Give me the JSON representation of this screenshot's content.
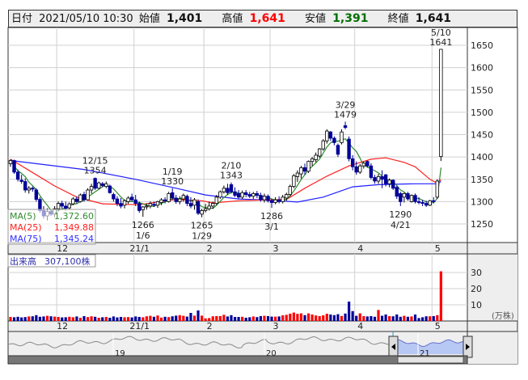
{
  "header": {
    "date_label": "日付",
    "datetime": "2021/05/10 10:30",
    "open_label": "始値",
    "open": "1,401",
    "high_label": "高値",
    "high": "1,641",
    "low_label": "安値",
    "low": "1,391",
    "close_label": "終値",
    "close": "1,641"
  },
  "legend": {
    "ma5_label": "MA(5)",
    "ma5_value": "1,372.60",
    "ma25_label": "MA(25)",
    "ma25_value": "1,349.88",
    "ma75_label": "MA(75)",
    "ma75_value": "1,345.24"
  },
  "volume_label": {
    "label": "出来高",
    "value": "307,100株"
  },
  "colors": {
    "up_candle": "#ffffff",
    "down_candle": "#000099",
    "ma5": "#2e8b2e",
    "ma25": "#ff2020",
    "ma75": "#2020ff",
    "vol_up": "#ff0000",
    "vol_down": "#000099",
    "vol_flat": "#999999",
    "high_text": "#ff0000",
    "low_text": "#007000"
  },
  "chart_data": {
    "type": "candlestick",
    "price_axis": {
      "ticks": [
        1650,
        1600,
        1550,
        1500,
        1450,
        1400,
        1350,
        1300,
        1250
      ],
      "ylim": [
        1212,
        1688
      ]
    },
    "month_ticks": [
      {
        "label": "12",
        "index": 13
      },
      {
        "label": "21/1",
        "index": 34
      },
      {
        "label": "2",
        "index": 53
      },
      {
        "label": "3",
        "index": 71
      },
      {
        "label": "4",
        "index": 94
      },
      {
        "label": "5",
        "index": 115
      }
    ],
    "ohlc": [
      [
        1385,
        1395,
        1378,
        1392
      ],
      [
        1392,
        1394,
        1362,
        1366
      ],
      [
        1366,
        1372,
        1345,
        1350
      ],
      [
        1348,
        1360,
        1340,
        1345
      ],
      [
        1345,
        1352,
        1320,
        1326
      ],
      [
        1326,
        1335,
        1318,
        1330
      ],
      [
        1330,
        1334,
        1322,
        1328
      ],
      [
        1326,
        1330,
        1300,
        1305
      ],
      [
        1305,
        1310,
        1275,
        1280
      ],
      [
        1280,
        1290,
        1262,
        1268
      ],
      [
        1268,
        1285,
        1258,
        1278
      ],
      [
        1278,
        1282,
        1268,
        1272
      ],
      [
        1272,
        1290,
        1265,
        1284
      ],
      [
        1284,
        1300,
        1278,
        1296
      ],
      [
        1296,
        1302,
        1285,
        1290
      ],
      [
        1290,
        1300,
        1280,
        1285
      ],
      [
        1286,
        1298,
        1282,
        1295
      ],
      [
        1295,
        1310,
        1292,
        1306
      ],
      [
        1306,
        1312,
        1296,
        1300
      ],
      [
        1300,
        1318,
        1298,
        1315
      ],
      [
        1316,
        1322,
        1300,
        1304
      ],
      [
        1304,
        1330,
        1302,
        1326
      ],
      [
        1326,
        1340,
        1318,
        1334
      ],
      [
        1352,
        1354,
        1326,
        1330
      ],
      [
        1330,
        1345,
        1328,
        1342
      ],
      [
        1340,
        1344,
        1332,
        1336
      ],
      [
        1334,
        1345,
        1330,
        1340
      ],
      [
        1335,
        1338,
        1318,
        1320
      ],
      [
        1316,
        1320,
        1300,
        1306
      ],
      [
        1306,
        1312,
        1290,
        1296
      ],
      [
        1296,
        1308,
        1285,
        1290
      ],
      [
        1292,
        1305,
        1285,
        1302
      ],
      [
        1300,
        1312,
        1295,
        1308
      ],
      [
        1310,
        1318,
        1300,
        1304
      ],
      [
        1304,
        1315,
        1290,
        1296
      ],
      [
        1296,
        1300,
        1275,
        1280
      ],
      [
        1282,
        1290,
        1266,
        1288
      ],
      [
        1288,
        1296,
        1282,
        1290
      ],
      [
        1290,
        1300,
        1285,
        1296
      ],
      [
        1294,
        1300,
        1288,
        1292
      ],
      [
        1292,
        1302,
        1286,
        1300
      ],
      [
        1298,
        1308,
        1292,
        1304
      ],
      [
        1304,
        1310,
        1296,
        1302
      ],
      [
        1300,
        1322,
        1298,
        1318
      ],
      [
        1320,
        1330,
        1305,
        1308
      ],
      [
        1308,
        1315,
        1295,
        1300
      ],
      [
        1300,
        1312,
        1294,
        1306
      ],
      [
        1306,
        1318,
        1300,
        1314
      ],
      [
        1312,
        1316,
        1290,
        1296
      ],
      [
        1296,
        1310,
        1285,
        1290
      ],
      [
        1292,
        1308,
        1282,
        1304
      ],
      [
        1300,
        1305,
        1270,
        1274
      ],
      [
        1272,
        1284,
        1265,
        1280
      ],
      [
        1280,
        1295,
        1276,
        1284
      ],
      [
        1284,
        1300,
        1280,
        1290
      ],
      [
        1290,
        1300,
        1284,
        1296
      ],
      [
        1296,
        1315,
        1292,
        1310
      ],
      [
        1310,
        1325,
        1306,
        1322
      ],
      [
        1322,
        1336,
        1318,
        1330
      ],
      [
        1330,
        1340,
        1315,
        1320
      ],
      [
        1338,
        1343,
        1318,
        1322
      ],
      [
        1322,
        1332,
        1310,
        1314
      ],
      [
        1318,
        1326,
        1306,
        1310
      ],
      [
        1310,
        1325,
        1306,
        1320
      ],
      [
        1320,
        1326,
        1310,
        1316
      ],
      [
        1316,
        1322,
        1308,
        1312
      ],
      [
        1312,
        1322,
        1306,
        1318
      ],
      [
        1318,
        1324,
        1308,
        1314
      ],
      [
        1314,
        1320,
        1300,
        1304
      ],
      [
        1304,
        1318,
        1298,
        1312
      ],
      [
        1312,
        1316,
        1298,
        1302
      ],
      [
        1302,
        1306,
        1286,
        1298
      ],
      [
        1298,
        1310,
        1294,
        1304
      ],
      [
        1304,
        1312,
        1296,
        1300
      ],
      [
        1300,
        1315,
        1296,
        1310
      ],
      [
        1308,
        1320,
        1302,
        1316
      ],
      [
        1316,
        1338,
        1312,
        1334
      ],
      [
        1334,
        1362,
        1330,
        1358
      ],
      [
        1356,
        1370,
        1344,
        1364
      ],
      [
        1362,
        1380,
        1352,
        1376
      ],
      [
        1376,
        1385,
        1360,
        1368
      ],
      [
        1368,
        1392,
        1364,
        1390
      ],
      [
        1390,
        1400,
        1380,
        1396
      ],
      [
        1394,
        1410,
        1388,
        1404
      ],
      [
        1402,
        1420,
        1398,
        1418
      ],
      [
        1418,
        1440,
        1414,
        1436
      ],
      [
        1436,
        1462,
        1430,
        1458
      ],
      [
        1456,
        1458,
        1436,
        1442
      ],
      [
        1442,
        1446,
        1426,
        1432
      ],
      [
        1426,
        1430,
        1400,
        1406
      ],
      [
        1432,
        1462,
        1428,
        1456
      ],
      [
        1470,
        1479,
        1462,
        1466
      ],
      [
        1440,
        1446,
        1390,
        1396
      ],
      [
        1396,
        1404,
        1370,
        1378
      ],
      [
        1378,
        1390,
        1360,
        1366
      ],
      [
        1366,
        1384,
        1362,
        1380
      ],
      [
        1380,
        1390,
        1374,
        1386
      ],
      [
        1390,
        1392,
        1376,
        1380
      ],
      [
        1380,
        1386,
        1350,
        1354
      ],
      [
        1354,
        1360,
        1340,
        1346
      ],
      [
        1346,
        1362,
        1340,
        1356
      ],
      [
        1356,
        1370,
        1330,
        1350
      ],
      [
        1360,
        1362,
        1334,
        1340
      ],
      [
        1340,
        1352,
        1332,
        1348
      ],
      [
        1348,
        1350,
        1326,
        1330
      ],
      [
        1332,
        1336,
        1306,
        1312
      ],
      [
        1318,
        1322,
        1290,
        1300
      ],
      [
        1310,
        1320,
        1298,
        1318
      ],
      [
        1318,
        1322,
        1302,
        1306
      ],
      [
        1300,
        1316,
        1298,
        1314
      ],
      [
        1314,
        1318,
        1296,
        1300
      ],
      [
        1300,
        1310,
        1294,
        1298
      ],
      [
        1298,
        1304,
        1290,
        1296
      ],
      [
        1296,
        1302,
        1288,
        1292
      ],
      [
        1292,
        1304,
        1290,
        1302
      ],
      [
        1302,
        1310,
        1296,
        1300
      ],
      [
        1310,
        1350,
        1306,
        1346
      ],
      [
        1401,
        1641,
        1391,
        1641
      ]
    ],
    "ma25": [
      [
        0,
        1395
      ],
      [
        5,
        1370
      ],
      [
        12,
        1335
      ],
      [
        18,
        1310
      ],
      [
        25,
        1295
      ],
      [
        35,
        1293
      ],
      [
        45,
        1305
      ],
      [
        52,
        1302
      ],
      [
        55,
        1297
      ],
      [
        62,
        1302
      ],
      [
        70,
        1304
      ],
      [
        75,
        1305
      ],
      [
        80,
        1330
      ],
      [
        86,
        1357
      ],
      [
        92,
        1380
      ],
      [
        98,
        1395
      ],
      [
        102,
        1398
      ],
      [
        107,
        1388
      ],
      [
        110,
        1378
      ],
      [
        114,
        1350
      ],
      [
        116,
        1341
      ],
      [
        117,
        1349
      ]
    ],
    "ma75": [
      [
        0,
        1392
      ],
      [
        20,
        1372
      ],
      [
        34,
        1350
      ],
      [
        45,
        1330
      ],
      [
        53,
        1315
      ],
      [
        62,
        1306
      ],
      [
        71,
        1303
      ],
      [
        78,
        1299
      ],
      [
        85,
        1310
      ],
      [
        93,
        1333
      ],
      [
        100,
        1338
      ],
      [
        110,
        1340
      ],
      [
        116,
        1340
      ],
      [
        117,
        1345
      ]
    ],
    "annotations": [
      {
        "date": "12/15",
        "price": "1354",
        "index": 23,
        "pos": "above"
      },
      {
        "date": "1/19",
        "price": "1330",
        "index": 44,
        "pos": "above"
      },
      {
        "date": "2/10",
        "price": "1343",
        "index": 60,
        "pos": "above"
      },
      {
        "date": "3/29",
        "price": "1479",
        "index": 91,
        "pos": "above"
      },
      {
        "date": "5/10",
        "price": "1641",
        "index": 117,
        "pos": "above"
      },
      {
        "date": "1/6",
        "price": "1266",
        "index": 36,
        "pos": "below"
      },
      {
        "date": "1/29",
        "price": "1265",
        "index": 52,
        "pos": "below"
      },
      {
        "date": "3/1",
        "price": "1286",
        "index": 71,
        "pos": "below"
      },
      {
        "date": "4/21",
        "price": "1290",
        "index": 106,
        "pos": "below"
      }
    ],
    "volume": {
      "unit": "(万株)",
      "ticks": [
        30,
        20,
        10
      ],
      "values": [
        2.5,
        2.3,
        2.6,
        2.2,
        2.4,
        2.8,
        2.9,
        3.6,
        2.6,
        2.8,
        3.2,
        2.9,
        2.7,
        2.5,
        2.2,
        2.3,
        2.6,
        2.3,
        2.8,
        2.0,
        3.0,
        2.4,
        2.9,
        2.6,
        2.0,
        2.3,
        2.5,
        2.0,
        2.8,
        2.2,
        2.5,
        2.3,
        2.4,
        2.2,
        2.8,
        2.5,
        2.3,
        2.9,
        3.2,
        2.6,
        3.4,
        2.1,
        2.6,
        2.4,
        2.9,
        3.3,
        3.6,
        3.2,
        2.7,
        5.0,
        3.3,
        6.5,
        3.3,
        1.6,
        1.8,
        2.9,
        3.0,
        3.0,
        3.8,
        2.8,
        3.6,
        2.5,
        2.5,
        2.6,
        2.0,
        2.3,
        2.8,
        2.4,
        3.0,
        3.2,
        3.0,
        2.7,
        2.7,
        2.8,
        3.5,
        3.8,
        4.5,
        5.2,
        4.4,
        4.7,
        3.6,
        4.7,
        4.0,
        3.4,
        3.0,
        3.5,
        4.5,
        4.0,
        3.6,
        4.2,
        3.1,
        4.6,
        12.0,
        6.1,
        3.2,
        4.7,
        3.0,
        2.8,
        3.0,
        2.6,
        6.8,
        3.2,
        4.0,
        3.0,
        2.9,
        4.0,
        2.6,
        3.2,
        2.6,
        2.8,
        4.0,
        1.8,
        2.3,
        2.9,
        2.9,
        3.0,
        3.6,
        30.71
      ]
    },
    "navigator": {
      "year_labels": [
        "19",
        "20",
        "21"
      ]
    }
  }
}
